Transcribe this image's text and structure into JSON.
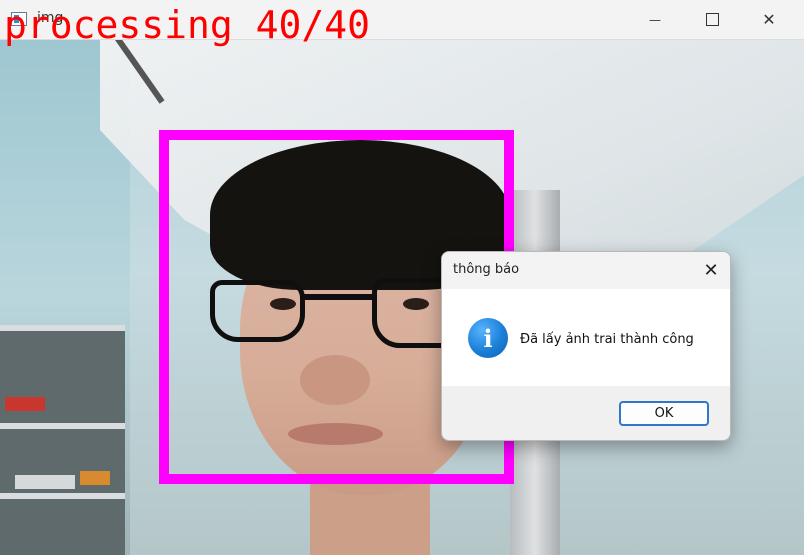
{
  "window": {
    "title": "img",
    "controls": {
      "minimize_glyph": "—",
      "close_glyph": "✕"
    }
  },
  "overlay": {
    "status_text": "processing 40/40",
    "text_color": "#ff0000",
    "face_box_color": "#ff00ff"
  },
  "dialog": {
    "title": "thông báo",
    "close_glyph": "✕",
    "icon": "info-icon",
    "icon_glyph": "i",
    "message": "Đã lấy ảnh trai thành công",
    "ok_label": "OK"
  }
}
